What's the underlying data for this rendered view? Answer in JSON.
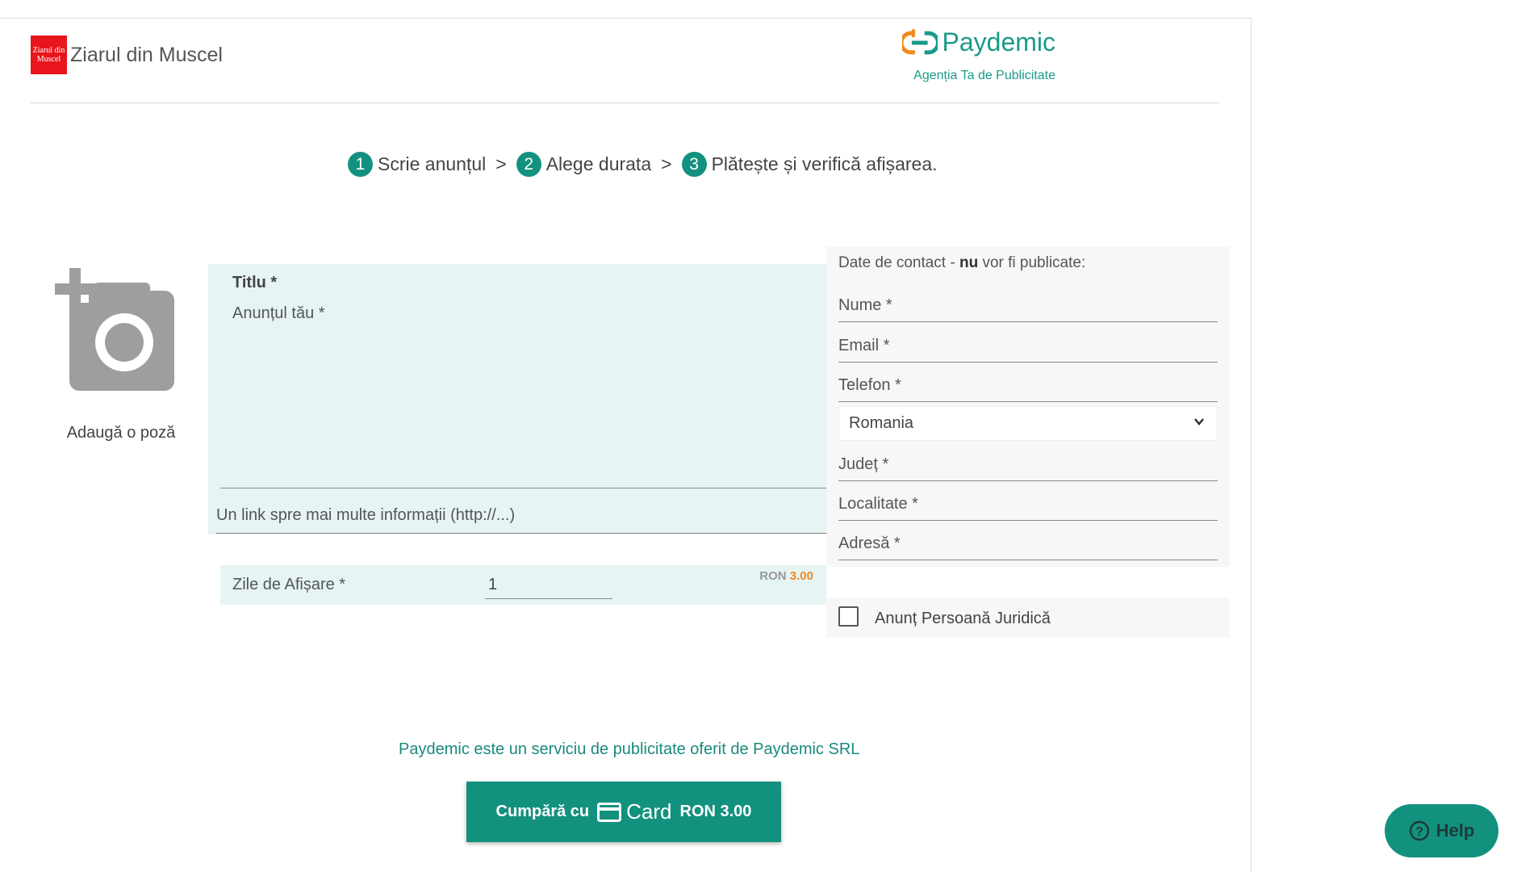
{
  "header": {
    "brand_logo_text": "Ziarul din Muscel",
    "brand_name": "Ziarul din Muscel",
    "agency_name": "Paydemic",
    "agency_tagline": "Agenția Ta de Publicitate"
  },
  "steps": [
    {
      "num": "1",
      "label": "Scrie anunțul"
    },
    {
      "num": "2",
      "label": "Alege durata"
    },
    {
      "num": "3",
      "label": "Plătește și verifică afișarea."
    }
  ],
  "step_separator": ">",
  "photo": {
    "label": "Adaugă o poză",
    "icon": "add-photo-icon"
  },
  "ad_form": {
    "title_placeholder": "Titlu *",
    "body_placeholder": "Anunțul tău *",
    "link_placeholder": "Un link spre mai multe informații (http://...)"
  },
  "days": {
    "label": "Zile de Afișare *",
    "value": "1",
    "currency": "RON",
    "price": "3.00"
  },
  "contact": {
    "heading_pre": "Date de contact - ",
    "heading_bold": "nu",
    "heading_post": " vor fi publicate:",
    "name_placeholder": "Nume *",
    "email_placeholder": "Email *",
    "phone_placeholder": "Telefon *",
    "country_value": "Romania",
    "county_placeholder": "Județ *",
    "city_placeholder": "Localitate *",
    "address_placeholder": "Adresă *",
    "legal_entity_label": "Anunț Persoană Juridică"
  },
  "footer": {
    "note": "Paydemic este un serviciu de publicitate oferit de Paydemic SRL",
    "buy_prefix": "Cumpără cu",
    "buy_card": "Card",
    "buy_price": "RON 3.00"
  },
  "help": {
    "label": "Help"
  },
  "colors": {
    "accent": "#13917f",
    "price": "#f0891f",
    "form_bg": "#e6f5f4",
    "logo_red": "#e8161c"
  }
}
